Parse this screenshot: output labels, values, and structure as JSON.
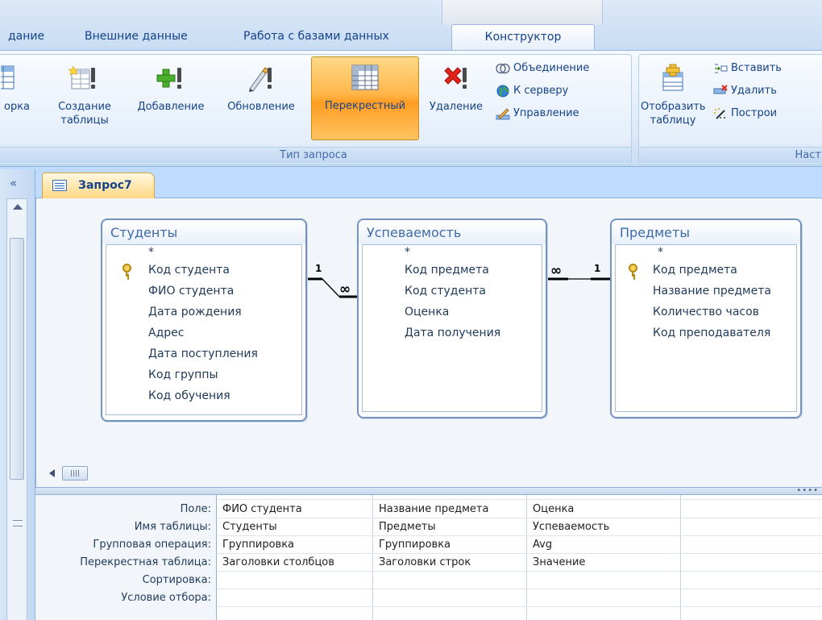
{
  "tabs": [
    {
      "label": "дание"
    },
    {
      "label": "Внешние данные"
    },
    {
      "label": "Работа с базами данных"
    },
    {
      "label": "Конструктор"
    }
  ],
  "ribbon": {
    "buttons": [
      {
        "label": "орка",
        "icon": "select-query-icon"
      },
      {
        "label": "Создание таблицы",
        "icon": "make-table-query-icon"
      },
      {
        "label": "Добавление",
        "icon": "append-query-icon"
      },
      {
        "label": "Обновление",
        "icon": "update-query-icon"
      },
      {
        "label": "Перекрестный",
        "icon": "crosstab-query-icon"
      },
      {
        "label": "Удаление",
        "icon": "delete-query-icon"
      }
    ],
    "small_buttons": [
      {
        "label": "Объединение",
        "icon": "union-icon"
      },
      {
        "label": "К серверу",
        "icon": "globe-icon"
      },
      {
        "label": "Управление",
        "icon": "pencil-icon"
      }
    ],
    "group_label": "Тип запроса",
    "show_table_label": "Отобразить таблицу",
    "setup_small": [
      {
        "label": "Вставить",
        "icon": "insert-rows-icon"
      },
      {
        "label": "Удалить",
        "icon": "delete-rows-icon"
      },
      {
        "label": "Построи",
        "icon": "builder-icon"
      }
    ],
    "setup_group_label": "Наст"
  },
  "nav": {
    "collapse": "«"
  },
  "document_tab": {
    "title": "Запрос7"
  },
  "tables": [
    {
      "title": "Студенты",
      "star": "*",
      "fields": [
        {
          "name": "Код студента",
          "key": true
        },
        {
          "name": "ФИО студента",
          "key": false
        },
        {
          "name": "Дата рождения",
          "key": false
        },
        {
          "name": "Адрес",
          "key": false
        },
        {
          "name": "Дата поступления",
          "key": false
        },
        {
          "name": "Код группы",
          "key": false
        },
        {
          "name": "Код обучения",
          "key": false
        }
      ]
    },
    {
      "title": "Успеваемость",
      "star": "*",
      "fields": [
        {
          "name": "Код предмета",
          "key": false
        },
        {
          "name": "Код студента",
          "key": false
        },
        {
          "name": "Оценка",
          "key": false
        },
        {
          "name": "Дата получения",
          "key": false
        }
      ]
    },
    {
      "title": "Предметы",
      "star": "*",
      "fields": [
        {
          "name": "Код предмета",
          "key": true
        },
        {
          "name": "Название предмета",
          "key": false
        },
        {
          "name": "Количество часов",
          "key": false
        },
        {
          "name": "Код преподавателя",
          "key": false
        }
      ]
    }
  ],
  "relations": [
    {
      "one": "1",
      "many": "∞"
    },
    {
      "one": "1",
      "many": "∞"
    }
  ],
  "qbe": {
    "row_labels": [
      "Поле:",
      "Имя таблицы:",
      "Групповая операция:",
      "Перекрестная таблица:",
      "Сортировка:",
      "Условие отбора:"
    ],
    "columns": [
      [
        "ФИО студента",
        "Студенты",
        "Группировка",
        "Заголовки столбцов",
        "",
        ""
      ],
      [
        "Название предмета",
        "Предметы",
        "Группировка",
        "Заголовки строк",
        "",
        ""
      ],
      [
        "Оценка",
        "Успеваемость",
        "Avg",
        "Значение",
        "",
        ""
      ],
      [
        "",
        "",
        "",
        "",
        "",
        ""
      ]
    ]
  }
}
